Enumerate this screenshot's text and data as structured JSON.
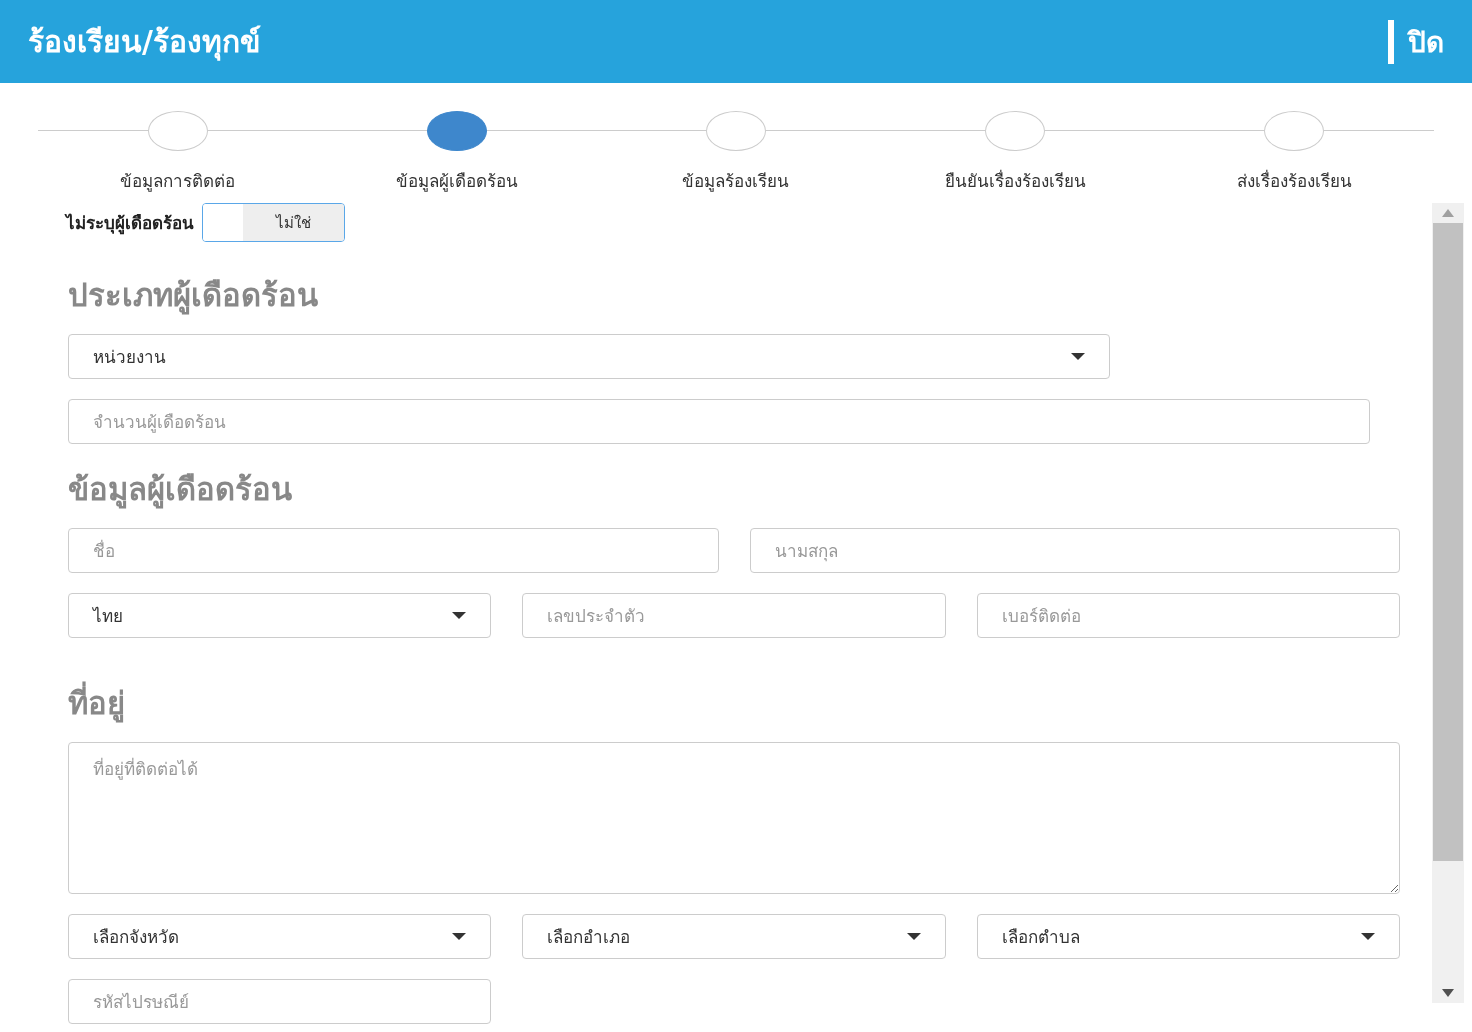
{
  "header": {
    "title": "ร้องเรียน/ร้องทุกข์",
    "close_label": "ปิด"
  },
  "steps": [
    {
      "label": "ข้อมูลการติดต่อ",
      "selected": false
    },
    {
      "label": "ข้อมูลผู้เดือดร้อน",
      "selected": true
    },
    {
      "label": "ข้อมูลร้องเรียน",
      "selected": false
    },
    {
      "label": "ยืนยันเรื่องร้องเรียน",
      "selected": false
    },
    {
      "label": "ส่งเรื่องร้องเรียน",
      "selected": false
    }
  ],
  "anonymous_toggle": {
    "label": "ไม่ระบุผู้เดือดร้อน",
    "off_label": "ไม่ใช่",
    "on": false
  },
  "sections": [
    {
      "title": "ประเภทผู้เดือดร้อน",
      "rows": [
        [
          {
            "kind": "select",
            "value": "หน่วยงาน"
          }
        ],
        [
          {
            "kind": "input",
            "placeholder": "จำนวนผู้เดือดร้อน"
          }
        ]
      ]
    },
    {
      "title": "ข้อมูลผู้เดือดร้อน",
      "rows": [
        [
          {
            "kind": "input",
            "placeholder": "ชื่อ"
          },
          {
            "kind": "input",
            "placeholder": "นามสกุล"
          }
        ],
        [
          {
            "kind": "select",
            "value": "ไทย"
          },
          {
            "kind": "input",
            "placeholder": "เลขประจำตัว"
          },
          {
            "kind": "input",
            "placeholder": "เบอร์ติดต่อ"
          }
        ]
      ]
    },
    {
      "title": "ที่อยู่",
      "rows": [
        [
          {
            "kind": "textarea",
            "placeholder": "ที่อยู่ที่ติดต่อได้"
          }
        ],
        [
          {
            "kind": "select",
            "value": "เลือกจังหวัด"
          },
          {
            "kind": "select",
            "value": "เลือกอำเภอ"
          },
          {
            "kind": "select",
            "value": "เลือกตำบล"
          }
        ],
        [
          {
            "kind": "input",
            "placeholder": "รหัสไปรษณีย์"
          }
        ]
      ]
    }
  ]
}
